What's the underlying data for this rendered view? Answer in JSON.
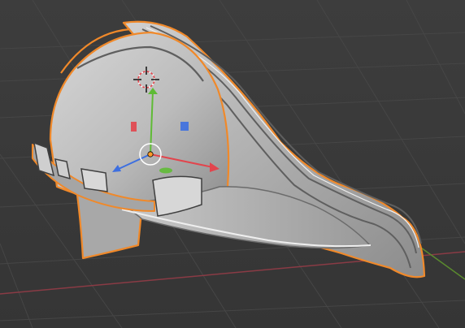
{
  "viewport": {
    "background_color": "#3a3a3a",
    "grid_color": "#474747",
    "axis_x_color": "#8a3b45",
    "axis_y_color": "#5a8b2e"
  },
  "selected_object": {
    "outline_color": "#f0892a",
    "body_color": "#b8b8b8",
    "shading_color": "#6c6c6c",
    "highlight_color": "#e8e8e8"
  },
  "transform_gizmo": {
    "x_color": "#e2454d",
    "y_color": "#5fbb35",
    "z_color": "#3d6fe0",
    "center_color": "#ffffff",
    "origin_color": "#ff9b2b"
  },
  "icons": {
    "camera": "3d-cursor-icon",
    "gizmo": "move-gizmo-icon"
  }
}
